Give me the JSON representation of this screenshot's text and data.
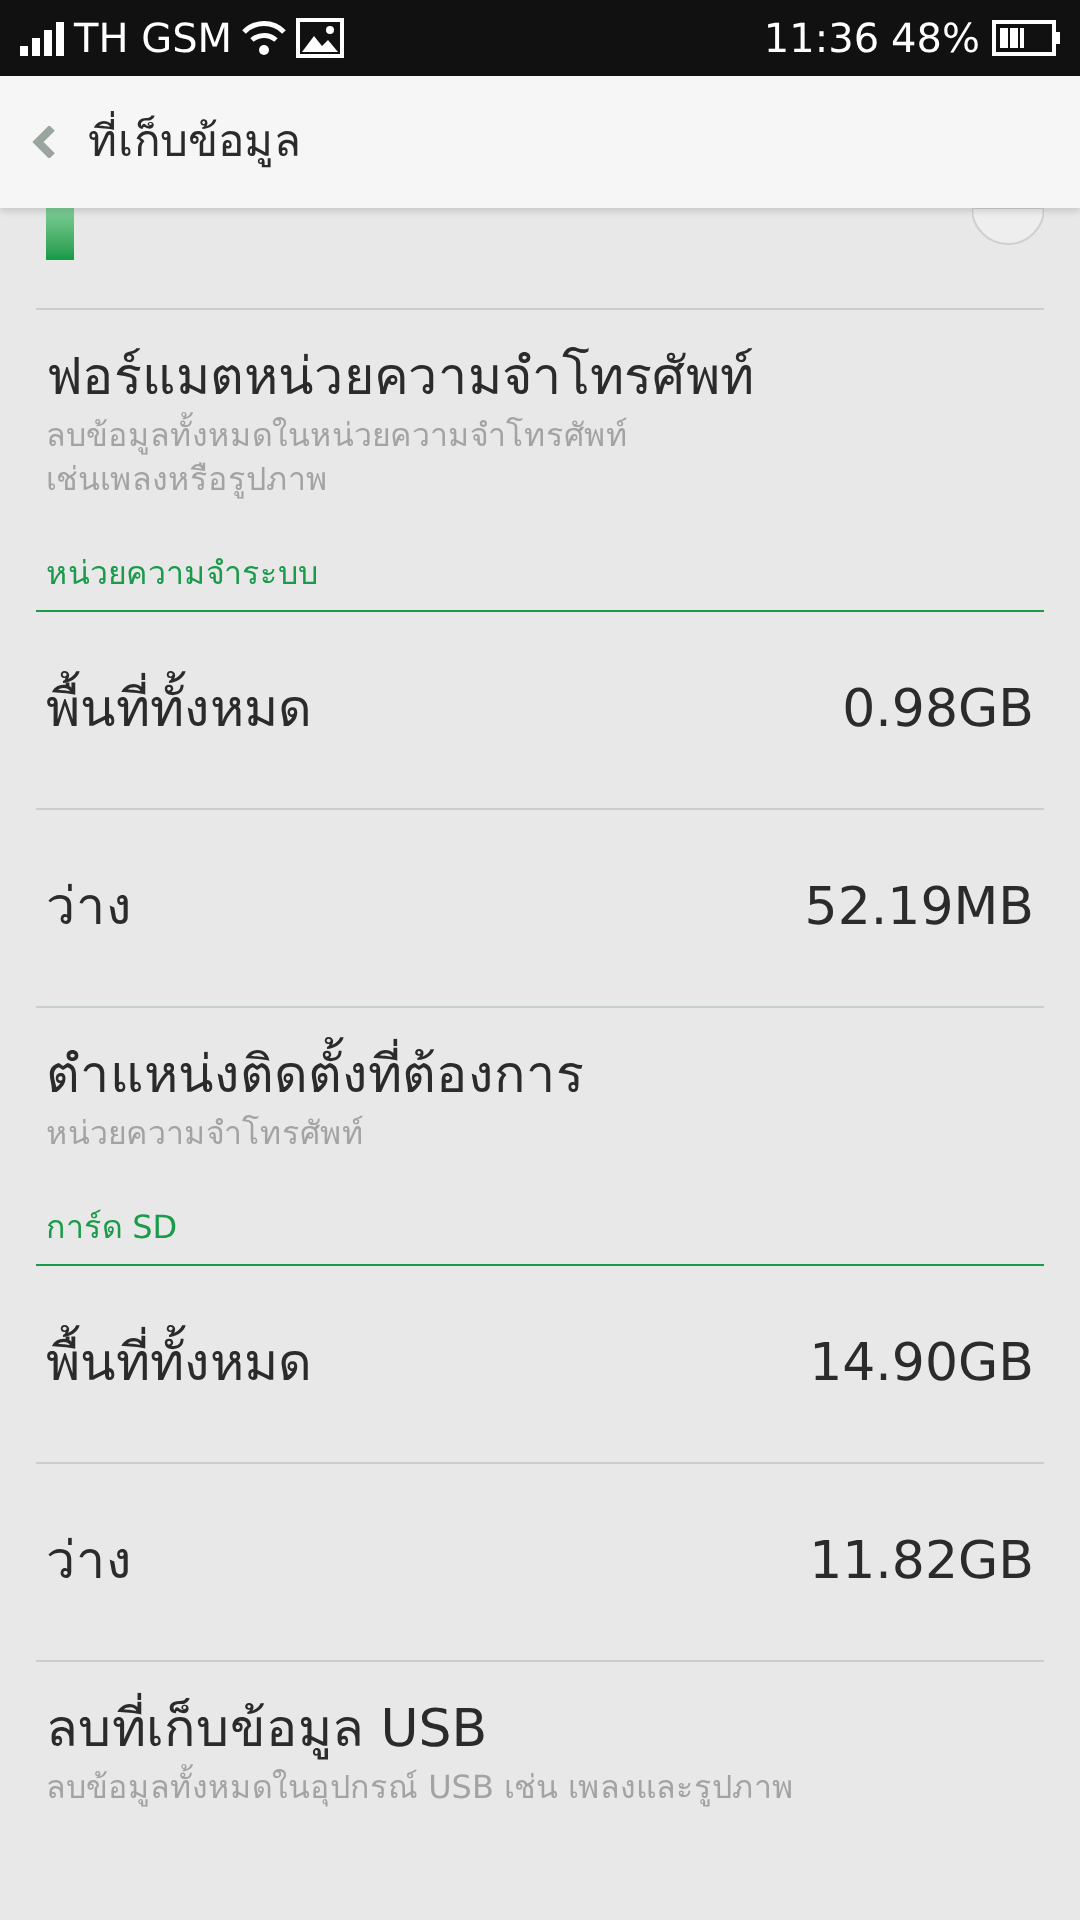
{
  "status_bar": {
    "carrier": "TH GSM",
    "time": "11:36",
    "battery": "48%"
  },
  "header": {
    "title": "ที่เก็บข้อมูล"
  },
  "items": [
    {
      "kind": "usage"
    },
    {
      "kind": "action",
      "title": "ฟอร์แมตหน่วยความจำโทรศัพท์",
      "subtitle": "ลบข้อมูลทั้งหมดในหน่วยความจำโทรศัพท์\nเช่นเพลงหรือรูปภาพ"
    },
    {
      "kind": "section",
      "label": "หน่วยความจำระบบ"
    },
    {
      "kind": "value",
      "label": "พื้นที่ทั้งหมด",
      "value": "0.98GB"
    },
    {
      "kind": "value",
      "label": "ว่าง",
      "value": "52.19MB"
    },
    {
      "kind": "action",
      "title": "ตำแหน่งติดตั้งที่ต้องการ",
      "subtitle": "หน่วยความจำโทรศัพท์"
    },
    {
      "kind": "section",
      "label": "การ์ด SD"
    },
    {
      "kind": "value",
      "label": "พื้นที่ทั้งหมด",
      "value": "14.90GB"
    },
    {
      "kind": "value",
      "label": "ว่าง",
      "value": "11.82GB"
    },
    {
      "kind": "action",
      "title": "ลบที่เก็บข้อมูล USB",
      "subtitle": "ลบข้อมูลทั้งหมดในอุปกรณ์ USB  เช่น เพลงและรูปภาพ"
    }
  ]
}
